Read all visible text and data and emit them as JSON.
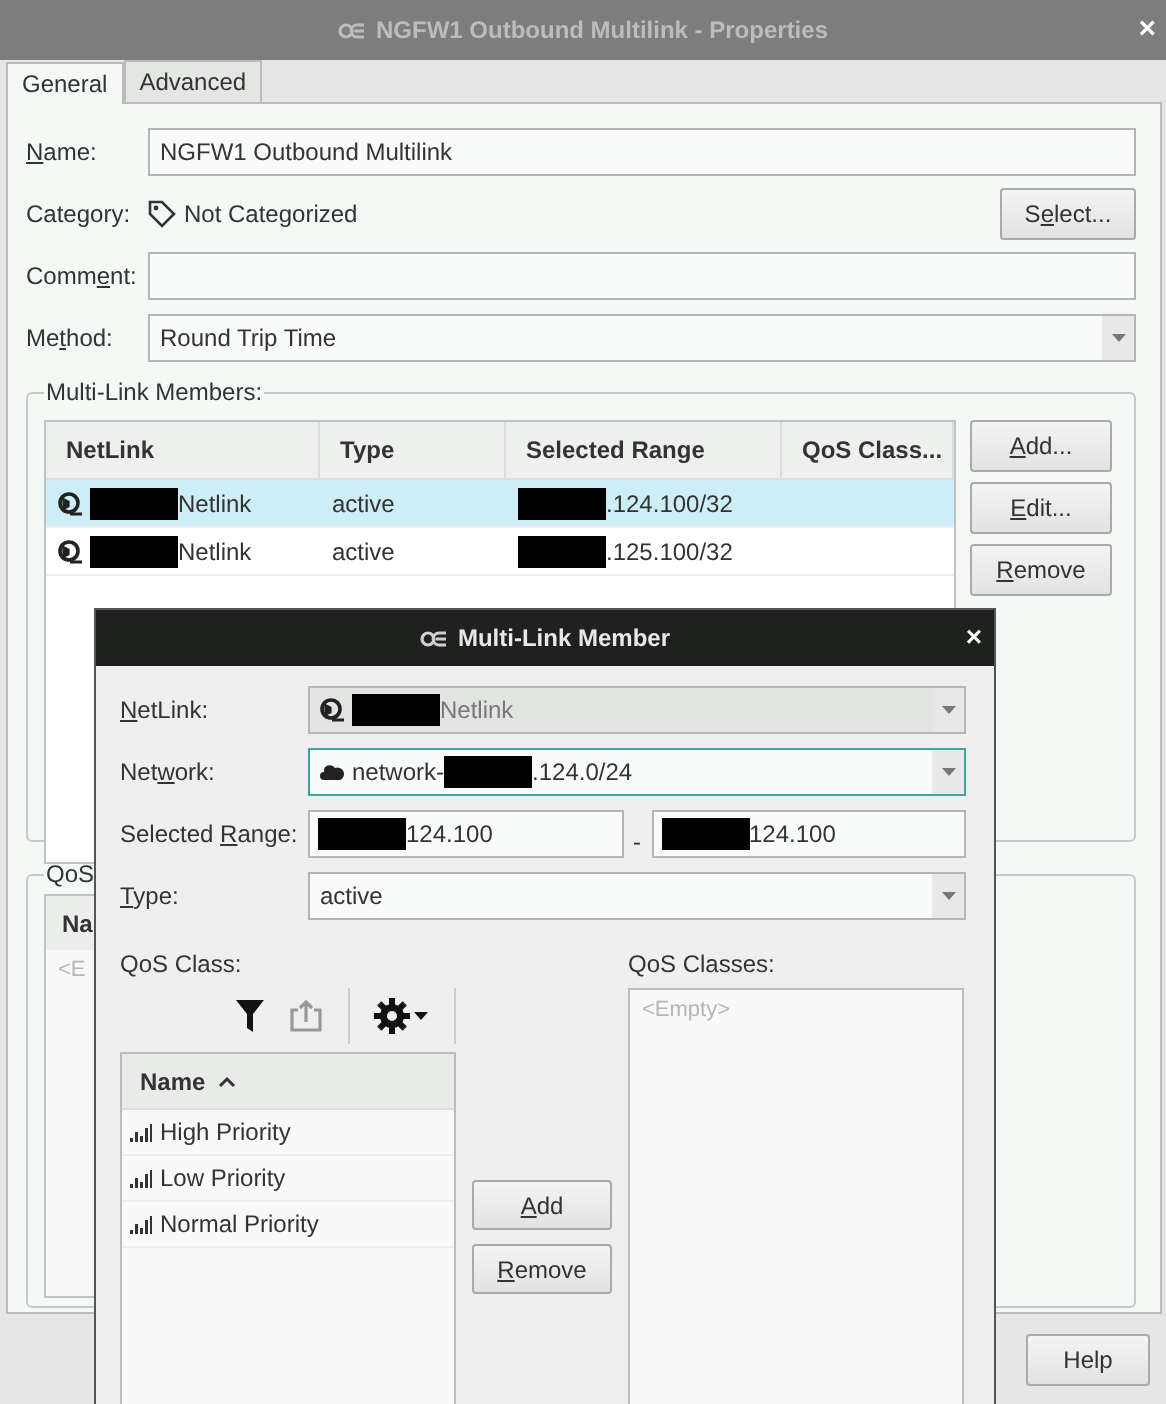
{
  "window": {
    "title": "NGFW1  Outbound Multilink - Properties",
    "close": "×"
  },
  "tabs": [
    {
      "label": "General",
      "selected": true
    },
    {
      "label": "Advanced",
      "selected": false
    }
  ],
  "form": {
    "name": {
      "label": {
        "key": "N",
        "after": "ame:"
      },
      "value": "NGFW1  Outbound Multilink"
    },
    "category": {
      "label": {
        "before": "Category:"
      },
      "value": "Not Categorized"
    },
    "select_button": {
      "label": {
        "before": "S",
        "key": "e",
        "after": "lect..."
      }
    },
    "comment": {
      "label": {
        "before": "Comm",
        "key": "e",
        "after": "nt:"
      }
    },
    "method": {
      "label": {
        "before": "Me",
        "key": "t",
        "after": "hod:"
      },
      "value": "Round Trip Time"
    }
  },
  "members": {
    "title": "Multi-Link Members:",
    "columns": [
      "NetLink",
      "Type",
      "Selected Range",
      "QoS Class..."
    ],
    "rows": [
      {
        "selected": true,
        "netlink": [
          {
            "kind": "redacted"
          },
          {
            "kind": "text",
            "text": "Netlink"
          }
        ],
        "type": "active",
        "range": [
          {
            "kind": "redacted"
          },
          {
            "kind": "text",
            "text": ".124.100/32"
          }
        ]
      },
      {
        "selected": false,
        "netlink": [
          {
            "kind": "redacted"
          },
          {
            "kind": "text",
            "text": "Netlink"
          }
        ],
        "type": "active",
        "range": [
          {
            "kind": "redacted"
          },
          {
            "kind": "text",
            "text": ".125.100/32"
          }
        ]
      }
    ],
    "buttons": [
      {
        "label": {
          "key": "A",
          "after": "dd..."
        }
      },
      {
        "label": {
          "key": "E",
          "after": "dit..."
        }
      },
      {
        "label": {
          "key": "R",
          "after": "emove"
        }
      }
    ]
  },
  "qos_group": {
    "title": "QoS",
    "column": "Na",
    "placeholder": "<E"
  },
  "footer_buttons": [
    {
      "label": "Help"
    }
  ],
  "dialog": {
    "title": "Multi-Link Member",
    "close": "×",
    "netlink": {
      "label": {
        "key": "N",
        "after": "etLink:"
      },
      "disabled": true,
      "value": [
        {
          "kind": "redacted"
        },
        {
          "kind": "text",
          "text": "Netlink"
        }
      ]
    },
    "network": {
      "label": {
        "before": "Net",
        "key": "w",
        "after": "ork:"
      },
      "focused": true,
      "value": [
        {
          "kind": "text",
          "text": "network-"
        },
        {
          "kind": "redacted"
        },
        {
          "kind": "text",
          "text": ".124.0/24"
        }
      ]
    },
    "range": {
      "label": {
        "before": "Selected ",
        "key": "R",
        "after": "ange:"
      },
      "from": [
        {
          "kind": "redacted"
        },
        {
          "kind": "text",
          "text": "124.100"
        }
      ],
      "separator": "-",
      "to": [
        {
          "kind": "redacted"
        },
        {
          "kind": "text",
          "text": "124.100"
        }
      ]
    },
    "type": {
      "label": {
        "key": "T",
        "after": "ype:"
      },
      "value": "active"
    },
    "qos_class": {
      "label": "QoS Class:",
      "column": "Name",
      "items": [
        "High Priority",
        "Low Priority",
        "Normal Priority"
      ]
    },
    "buttons": [
      {
        "label": {
          "key": "A",
          "after": "dd"
        }
      },
      {
        "label": {
          "key": "R",
          "after": "emove"
        }
      }
    ],
    "qos_classes": {
      "label": "QoS Classes:",
      "placeholder": "<Empty>"
    }
  }
}
